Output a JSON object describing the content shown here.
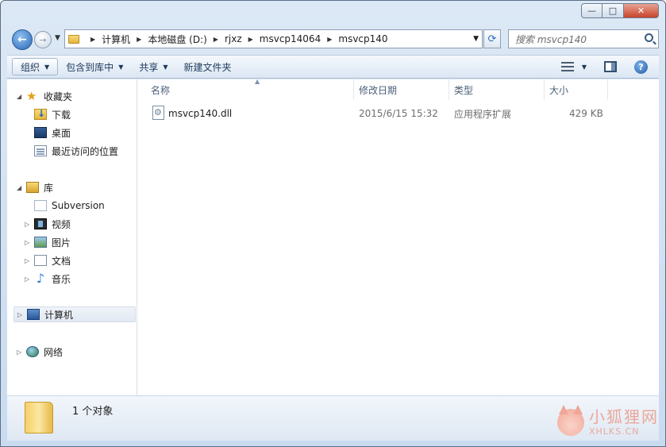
{
  "window": {
    "minimize": "—",
    "maximize": "□",
    "close": "✕"
  },
  "nav": {
    "back": "←",
    "forward": "→",
    "breadcrumb": [
      "计算机",
      "本地磁盘 (D:)",
      "rjxz",
      "msvcp14064",
      "msvcp140"
    ],
    "search_placeholder": "搜索 msvcp140"
  },
  "toolbar": {
    "organize": "组织",
    "include_library": "包含到库中",
    "share": "共享",
    "new_folder": "新建文件夹",
    "help": "?"
  },
  "sidebar": {
    "favorites": "收藏夹",
    "downloads": "下载",
    "desktop": "桌面",
    "recent": "最近访问的位置",
    "libraries": "库",
    "subversion": "Subversion",
    "videos": "视频",
    "pictures": "图片",
    "documents": "文档",
    "music": "音乐",
    "computer": "计算机",
    "network": "网络"
  },
  "columns": {
    "name": "名称",
    "modified": "修改日期",
    "type": "类型",
    "size": "大小"
  },
  "files": [
    {
      "name": "msvcp140.dll",
      "modified": "2015/6/15 15:32",
      "type": "应用程序扩展",
      "size": "429 KB"
    }
  ],
  "details": {
    "count": "1 个对象"
  },
  "watermark": {
    "cn": "小狐狸网",
    "en": "XHLKS.CN"
  }
}
